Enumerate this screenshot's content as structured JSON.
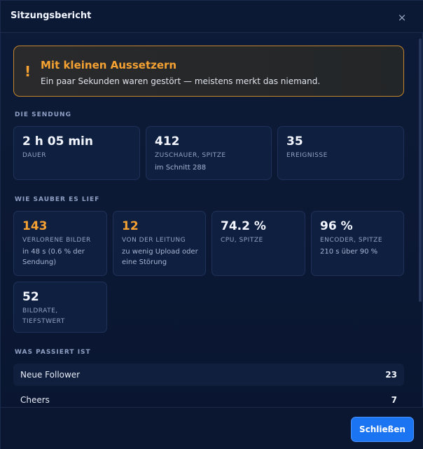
{
  "dialog": {
    "title": "Sitzungsbericht",
    "close_icon": "×",
    "close_button_label": "Schließen"
  },
  "alert": {
    "icon": "!",
    "icon_name": "warning-icon",
    "title": "Mit kleinen Aussetzern",
    "text": "Ein paar Sekunden waren gestört — meistens merkt das niemand.",
    "accent_color": "#f5a233"
  },
  "broadcast": {
    "section_label": "DIE SENDUNG",
    "cards": [
      {
        "value": "2 h 05 min",
        "label": "DAUER",
        "sub": ""
      },
      {
        "value": "412",
        "label": "ZUSCHAUER, SPITZE",
        "sub": "im Schnitt 288"
      },
      {
        "value": "35",
        "label": "EREIGNISSE",
        "sub": ""
      }
    ]
  },
  "quality": {
    "section_label": "WIE SAUBER ES LIEF",
    "cards": [
      {
        "value": "143",
        "label": "VERLORENE BILDER",
        "sub": "in 48 s (0.6 % der Sendung)",
        "warn": true
      },
      {
        "value": "12",
        "label": "VON DER LEITUNG",
        "sub": "zu wenig Upload oder eine Störung",
        "warn": true
      },
      {
        "value": "74.2 %",
        "label": "CPU, SPITZE",
        "sub": "",
        "warn": false
      },
      {
        "value": "96 %",
        "label": "ENCODER, SPITZE",
        "sub": "210 s über 90 %",
        "warn": false
      },
      {
        "value": "52",
        "label": "BILDRATE, TIEFSTWERT",
        "sub": "",
        "warn": false
      }
    ]
  },
  "events": {
    "section_label": "WAS PASSIERT IST",
    "rows": [
      {
        "name": "Neue Follower",
        "count": "23"
      },
      {
        "name": "Cheers",
        "count": "7"
      }
    ]
  }
}
